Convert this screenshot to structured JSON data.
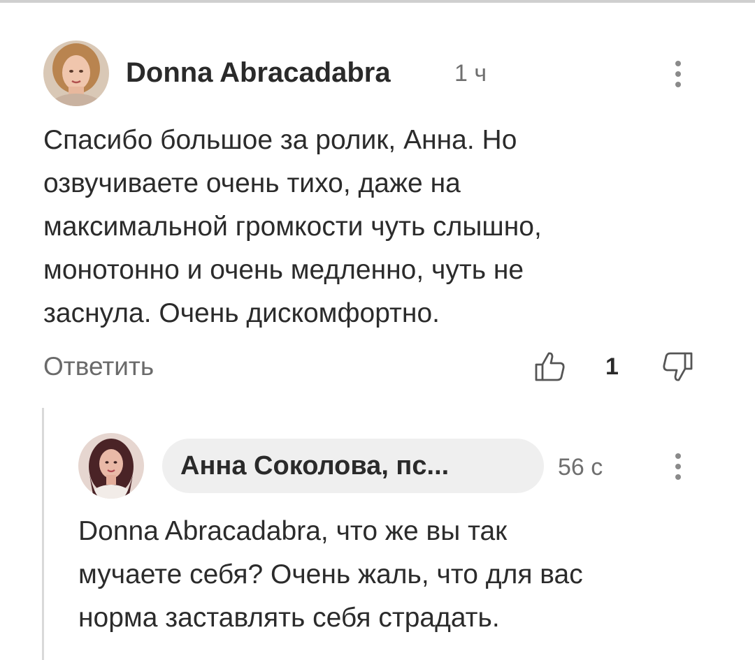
{
  "comment": {
    "author": "Donna Abracadabra",
    "time": "1 ч",
    "text_lines": [
      "Спасибо большое за ролик, Анна. Но",
      "озвучиваете очень тихо, даже на",
      "максимальной громкости чуть слышно,",
      "монотонно и очень медленно, чуть не",
      "заснула. Очень дискомфортно."
    ],
    "reply_label": "Ответить",
    "like_count": "1",
    "icons": {
      "menu": "more-vertical-icon",
      "like": "thumbs-up-icon",
      "dislike": "thumbs-down-icon"
    }
  },
  "reply": {
    "author": "Анна Соколова, пс...",
    "time": "56 с",
    "text_lines": [
      "Donna Abracadabra, что же вы так",
      "мучаете себя? Очень жаль, что для вас",
      "норма заставлять себя страдать."
    ],
    "icons": {
      "menu": "more-vertical-icon"
    }
  },
  "colors": {
    "text": "#2b2b2b",
    "muted": "#6f6f6f",
    "pill_bg": "#efefef",
    "thread_line": "#d9d9d9"
  }
}
